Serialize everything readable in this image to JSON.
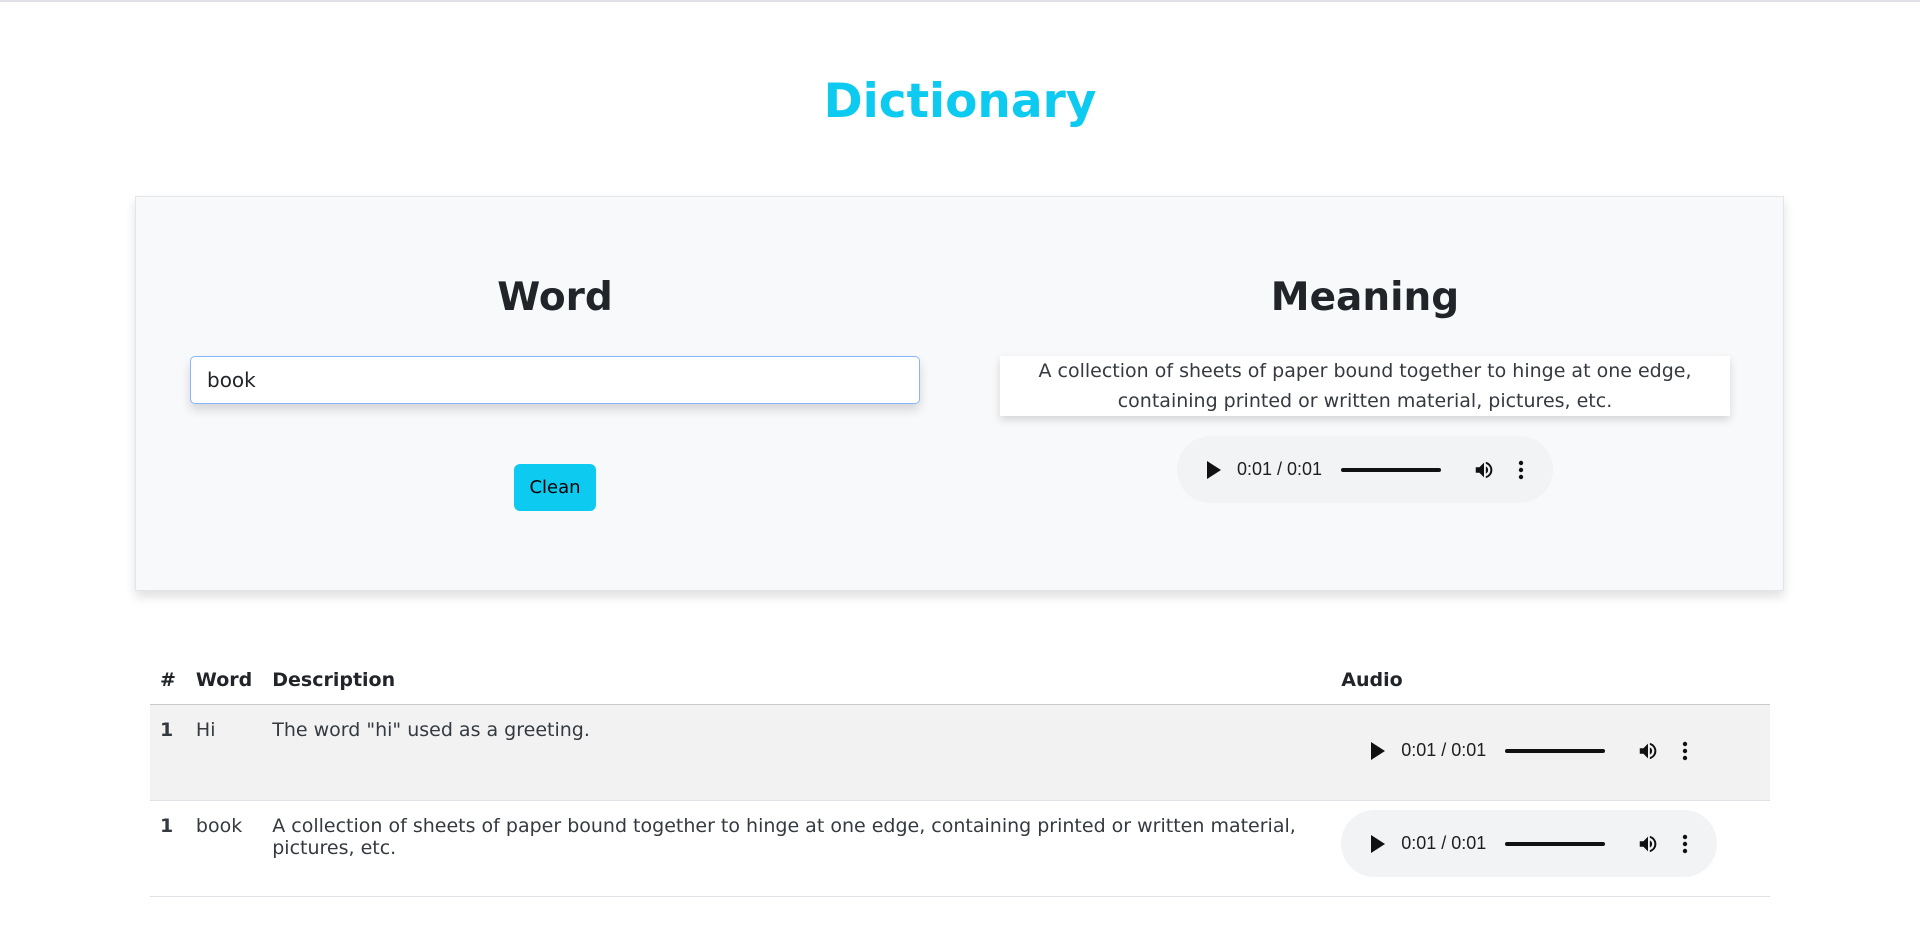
{
  "page": {
    "title": "Dictionary"
  },
  "search": {
    "word_heading": "Word",
    "meaning_heading": "Meaning",
    "input_value": "book",
    "clean_label": "Clean",
    "meaning_text": "A collection of sheets of paper bound together to hinge at one edge, containing printed or written material, pictures, etc.",
    "audio_time": "0:01 / 0:01"
  },
  "table": {
    "headers": [
      "#",
      "Word",
      "Description",
      "Audio"
    ],
    "rows": [
      {
        "num": "1",
        "word": "Hi",
        "description": "The word \"hi\" used as a greeting.",
        "audio_time": "0:01 / 0:01"
      },
      {
        "num": "1",
        "word": "book",
        "description": "A collection of sheets of paper bound together to hinge at one edge, containing printed or written material, pictures, etc.",
        "audio_time": "0:01 / 0:01"
      }
    ]
  },
  "colors": {
    "accent": "#0dcaf0",
    "panel_bg": "#f8f9fa",
    "audio_bg": "#f1f3f4"
  },
  "icons": {
    "play": "play-icon",
    "volume": "volume-icon",
    "more": "more-vertical-icon"
  }
}
